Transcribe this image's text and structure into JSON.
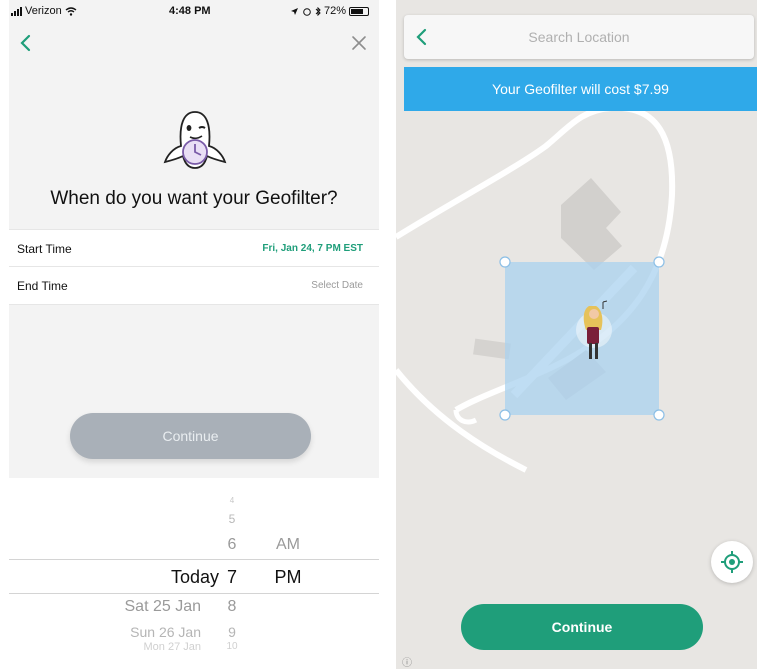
{
  "left": {
    "status": {
      "carrier": "Verizon",
      "time": "4:48 PM",
      "battery": "72%"
    },
    "question": "When do you want your Geofilter?",
    "start": {
      "label": "Start Time",
      "value": "Fri, Jan 24, 7 PM EST"
    },
    "end": {
      "label": "End Time",
      "value": "Select Date"
    },
    "continue_label": "Continue",
    "picker": {
      "days": [
        "Today",
        "Sat 25 Jan",
        "Sun 26 Jan",
        "Mon 27 Jan"
      ],
      "hours": [
        "4",
        "5",
        "6",
        "7",
        "8",
        "9",
        "10"
      ],
      "meridiem": [
        "AM",
        "PM"
      ]
    }
  },
  "right": {
    "search_placeholder": "Search Location",
    "cost_text": "Your Geofilter will cost $7.99",
    "continue_label": "Continue",
    "info_glyph": "ⓘ"
  },
  "colors": {
    "accent_green": "#1f9e7a",
    "banner_blue": "#2fa9e9",
    "disabled_grey": "#a9b0b8"
  }
}
